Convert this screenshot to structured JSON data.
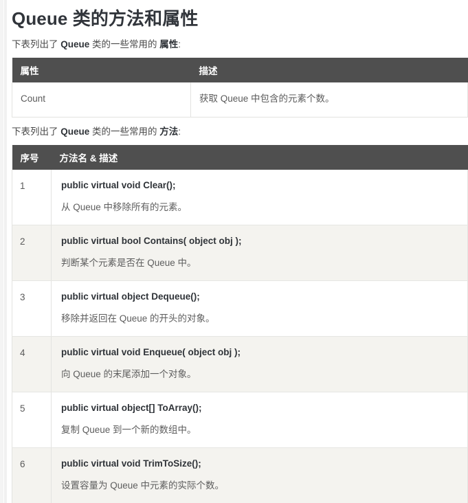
{
  "page": {
    "title": "Queue 类的方法和属性",
    "properties_lead": {
      "prefix": "下表列出了 ",
      "class_name": "Queue",
      "middle": " 类的一些常用的 ",
      "kind": "属性",
      "suffix": ":"
    },
    "methods_lead": {
      "prefix": "下表列出了 ",
      "class_name": "Queue",
      "middle": " 类的一些常用的 ",
      "kind": "方法",
      "suffix": ":"
    }
  },
  "colors": {
    "header_bg": "#4f4f4f",
    "header_text": "#ffffff",
    "alt_row_bg": "#f4f3ef",
    "border": "#e3e3e0",
    "title_text": "#31353b",
    "body_text": "#5a5a5a",
    "sig_text": "#2f3338",
    "page_bg": "#ffffff",
    "rail_bg": "#f4f4f4"
  },
  "properties_table": {
    "columns": [
      "属性",
      "描述"
    ],
    "rows": [
      {
        "name": "Count",
        "description": "获取 Queue 中包含的元素个数。"
      }
    ]
  },
  "methods_table": {
    "columns": [
      "序号",
      "方法名 & 描述"
    ],
    "rows": [
      {
        "index": "1",
        "signature": "public virtual void Clear();",
        "description": "从 Queue 中移除所有的元素。"
      },
      {
        "index": "2",
        "signature": "public virtual bool Contains( object obj );",
        "description": "判断某个元素是否在 Queue 中。"
      },
      {
        "index": "3",
        "signature": "public virtual object Dequeue();",
        "description": "移除并返回在 Queue 的开头的对象。"
      },
      {
        "index": "4",
        "signature": "public virtual void Enqueue( object obj );",
        "description": "向 Queue 的末尾添加一个对象。"
      },
      {
        "index": "5",
        "signature": "public virtual object[] ToArray();",
        "description": "复制 Queue 到一个新的数组中。"
      },
      {
        "index": "6",
        "signature": "public virtual void TrimToSize();",
        "description": "设置容量为 Queue 中元素的实际个数。"
      }
    ]
  }
}
